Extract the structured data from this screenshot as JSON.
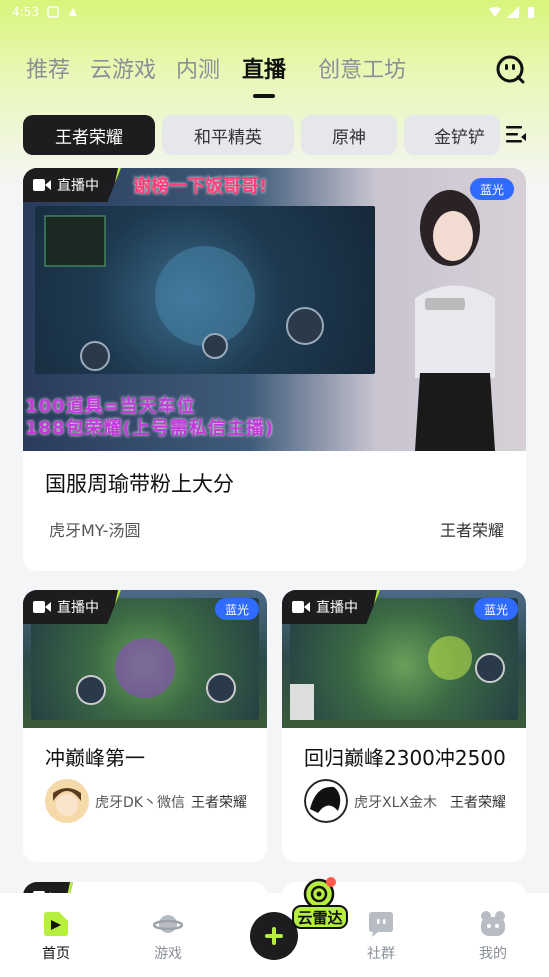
{
  "status_bar": {
    "time": "4:53"
  },
  "main_tabs": [
    {
      "label": "推荐"
    },
    {
      "label": "云游戏"
    },
    {
      "label": "内测"
    },
    {
      "label": "直播"
    },
    {
      "label": "创意工坊"
    }
  ],
  "game_chips": [
    {
      "label": "王者荣耀"
    },
    {
      "label": "和平精英"
    },
    {
      "label": "原神"
    },
    {
      "label": "金铲铲"
    }
  ],
  "live_label": "直播中",
  "quality_label": "蓝光",
  "featured": {
    "thumb_banner": "谢榜一下饭哥哥!",
    "thumb_caption_1": "100道具=当天车位",
    "thumb_caption_2": "188包荣耀(上号需私信主播)",
    "title": "国服周瑜带粉上大分",
    "streamer": "虎牙MY-汤圆",
    "game": "王者荣耀"
  },
  "cards": [
    {
      "title": "冲巅峰第一",
      "streamer": "虎牙DK丶微信",
      "game": "王者荣耀"
    },
    {
      "title": "回归巅峰2300冲2500",
      "streamer": "虎牙XLX金木",
      "game": "王者荣耀"
    }
  ],
  "radar_label": "云雷达",
  "bottom_nav": [
    {
      "label": "首页"
    },
    {
      "label": "游戏"
    },
    {
      "label": "社群"
    },
    {
      "label": "我的"
    }
  ],
  "colors": {
    "accent": "#b6ef3d",
    "quality": "#2f6bff",
    "dark": "#1d1d1f"
  }
}
